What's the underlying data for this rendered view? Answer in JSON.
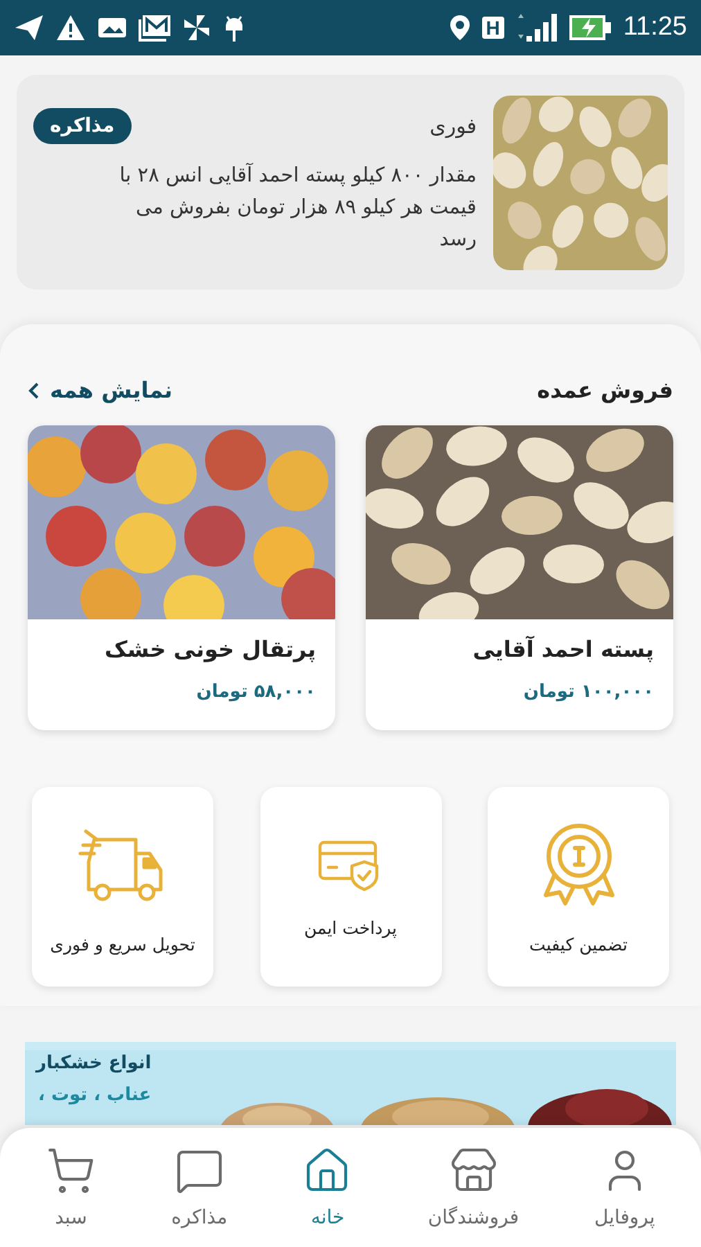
{
  "status_bar": {
    "network_type": "H",
    "time": "11:25"
  },
  "offer": {
    "tag": "فوری",
    "description": "مقدار ۸۰۰ کیلو پسته احمد آقایی انس ۲۸ با قیمت هر کیلو ۸۹ هزار تومان بفروش می رسد",
    "action": "مذاکره"
  },
  "wholesale": {
    "title": "فروش عمده",
    "show_all": "نمایش همه",
    "products": [
      {
        "name": "پسته احمد آقایی",
        "price": "۱۰۰,۰۰۰ تومان",
        "kind": "pistachio"
      },
      {
        "name": "پرتقال خونی خشک",
        "price": "۵۸,۰۰۰ تومان",
        "kind": "orange"
      }
    ]
  },
  "features": [
    {
      "label": "تضمین کیفیت",
      "kind": "medal"
    },
    {
      "label": "پرداخت ایمن",
      "kind": "card"
    },
    {
      "label": "تحویل سریع و فوری",
      "kind": "truck"
    }
  ],
  "banner": {
    "title": "انواع خشکبار",
    "subtitle": "عناب ، توت ،"
  },
  "bottom_nav": [
    {
      "label": "پروفایل",
      "kind": "user",
      "selected": false
    },
    {
      "label": "فروشندگان",
      "kind": "store",
      "selected": false
    },
    {
      "label": "خانه",
      "kind": "home",
      "selected": true
    },
    {
      "label": "مذاکره",
      "kind": "chat",
      "selected": false
    },
    {
      "label": "سبد",
      "kind": "cart",
      "selected": false
    }
  ]
}
